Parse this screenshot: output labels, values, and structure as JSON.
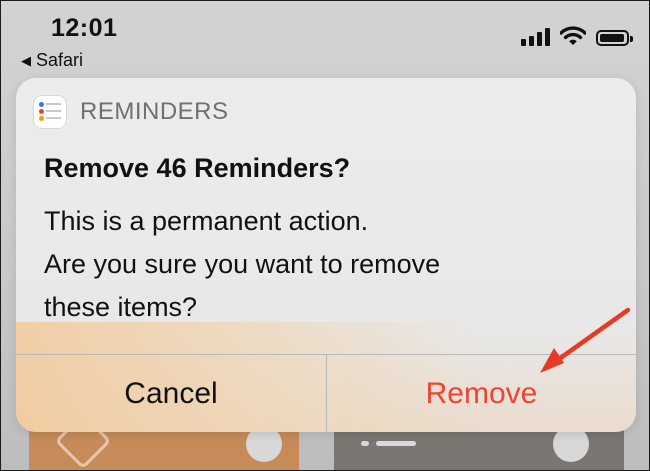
{
  "status_bar": {
    "time": "12:01",
    "back_app": "Safari"
  },
  "alert": {
    "app_name": "REMINDERS",
    "title": "Remove 46 Reminders?",
    "message_line1": "This is a permanent action.",
    "message_line2": "Are you sure you want to remove",
    "message_line3": "these items?",
    "cancel_label": "Cancel",
    "remove_label": "Remove"
  },
  "colors": {
    "destructive": "#ee4433",
    "annotation_arrow": "#e53a23"
  },
  "icons": [
    "back-arrow-icon",
    "signal-icon",
    "wifi-icon",
    "battery-icon",
    "reminders-app-icon",
    "annotation-arrow-icon"
  ]
}
